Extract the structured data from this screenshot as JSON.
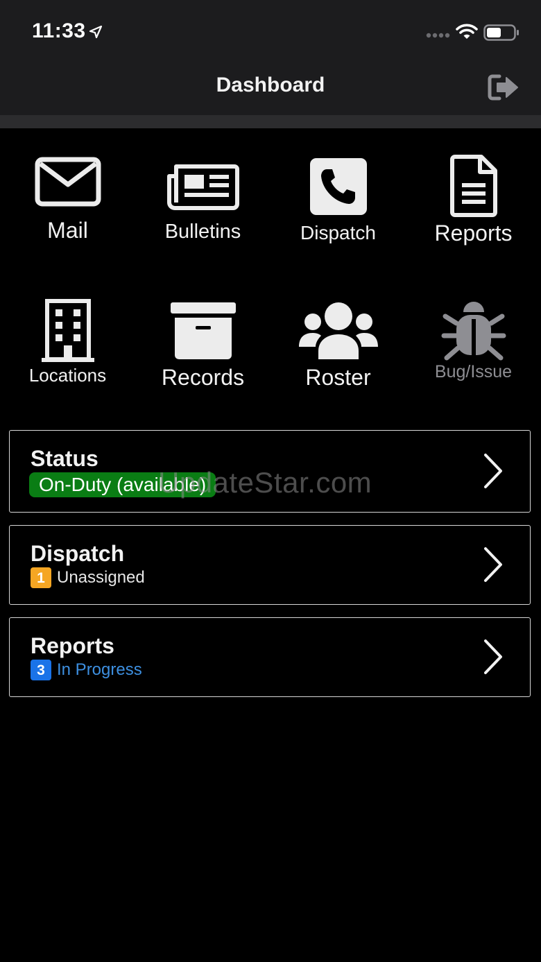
{
  "status_bar": {
    "time": "11:33"
  },
  "nav": {
    "title": "Dashboard"
  },
  "tiles": [
    {
      "label": "Mail",
      "icon": "envelope-icon"
    },
    {
      "label": "Bulletins",
      "icon": "newspaper-icon"
    },
    {
      "label": "Dispatch",
      "icon": "phone-icon"
    },
    {
      "label": "Reports",
      "icon": "document-icon"
    },
    {
      "label": "Locations",
      "icon": "building-icon"
    },
    {
      "label": "Records",
      "icon": "archive-box-icon"
    },
    {
      "label": "Roster",
      "icon": "users-icon"
    },
    {
      "label": "Bug/Issue",
      "icon": "bug-icon"
    }
  ],
  "cards": {
    "status": {
      "title": "Status",
      "value": "On-Duty (available)"
    },
    "dispatch": {
      "title": "Dispatch",
      "count": "1",
      "text": "Unassigned"
    },
    "reports": {
      "title": "Reports",
      "count": "3",
      "text": "In Progress"
    }
  },
  "watermark": "UpdateStar.com",
  "colors": {
    "status_green": "#0a7d14",
    "dispatch_badge": "#f5a623",
    "reports_badge": "#1a73e8",
    "in_progress_text": "#3d8fe0",
    "disabled_tile": "#8e8e93"
  }
}
